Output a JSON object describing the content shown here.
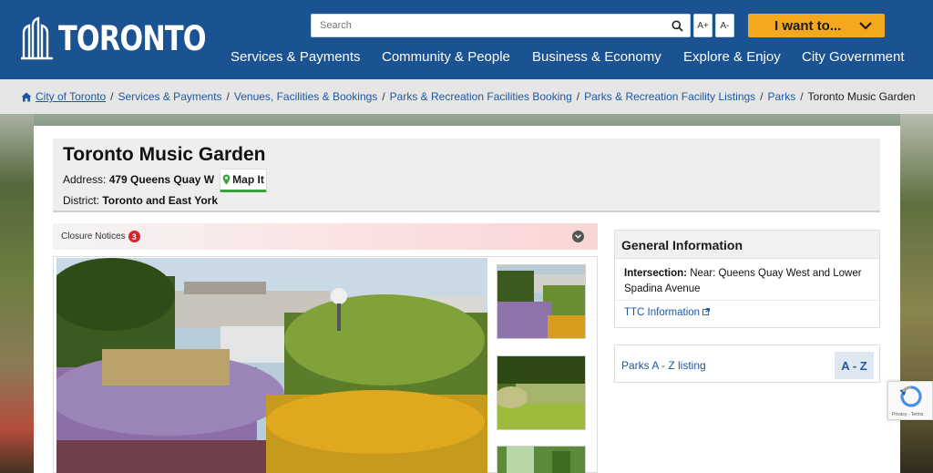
{
  "header": {
    "logo_text": "TORONTO",
    "search_placeholder": "Search",
    "font_increase": "A+",
    "font_decrease": "A-",
    "i_want_to": "I want to...",
    "nav": [
      "Services & Payments",
      "Community & People",
      "Business & Economy",
      "Explore & Enjoy",
      "City Government"
    ]
  },
  "breadcrumb": {
    "items": [
      "City of Toronto",
      "Services & Payments",
      "Venues, Facilities & Bookings",
      "Parks & Recreation Facilities Booking",
      "Parks & Recreation Facility Listings",
      "Parks"
    ],
    "current": "Toronto Music Garden",
    "separator": "/"
  },
  "park": {
    "title": "Toronto Music Garden",
    "address_label": "Address:",
    "address": "479 Queens Quay W",
    "map_it": "Map It",
    "district_label": "District:",
    "district": "Toronto and East York"
  },
  "closure": {
    "label": "Closure Notices",
    "count": "3"
  },
  "general_info": {
    "heading": "General Information",
    "intersection_label": "Intersection:",
    "intersection": "Near: Queens Quay West and Lower Spadina Avenue",
    "ttc_link": "TTC Information"
  },
  "az": {
    "link": "Parks A - Z listing",
    "badge": "A - Z"
  },
  "recaptcha": {
    "terms": "Privacy - Terms"
  },
  "colors": {
    "header_blue": "#1a5292",
    "accent_orange": "#f4a81d",
    "link_blue": "#1f57a0",
    "badge_red": "#d8232a",
    "map_green": "#3aa23c"
  }
}
